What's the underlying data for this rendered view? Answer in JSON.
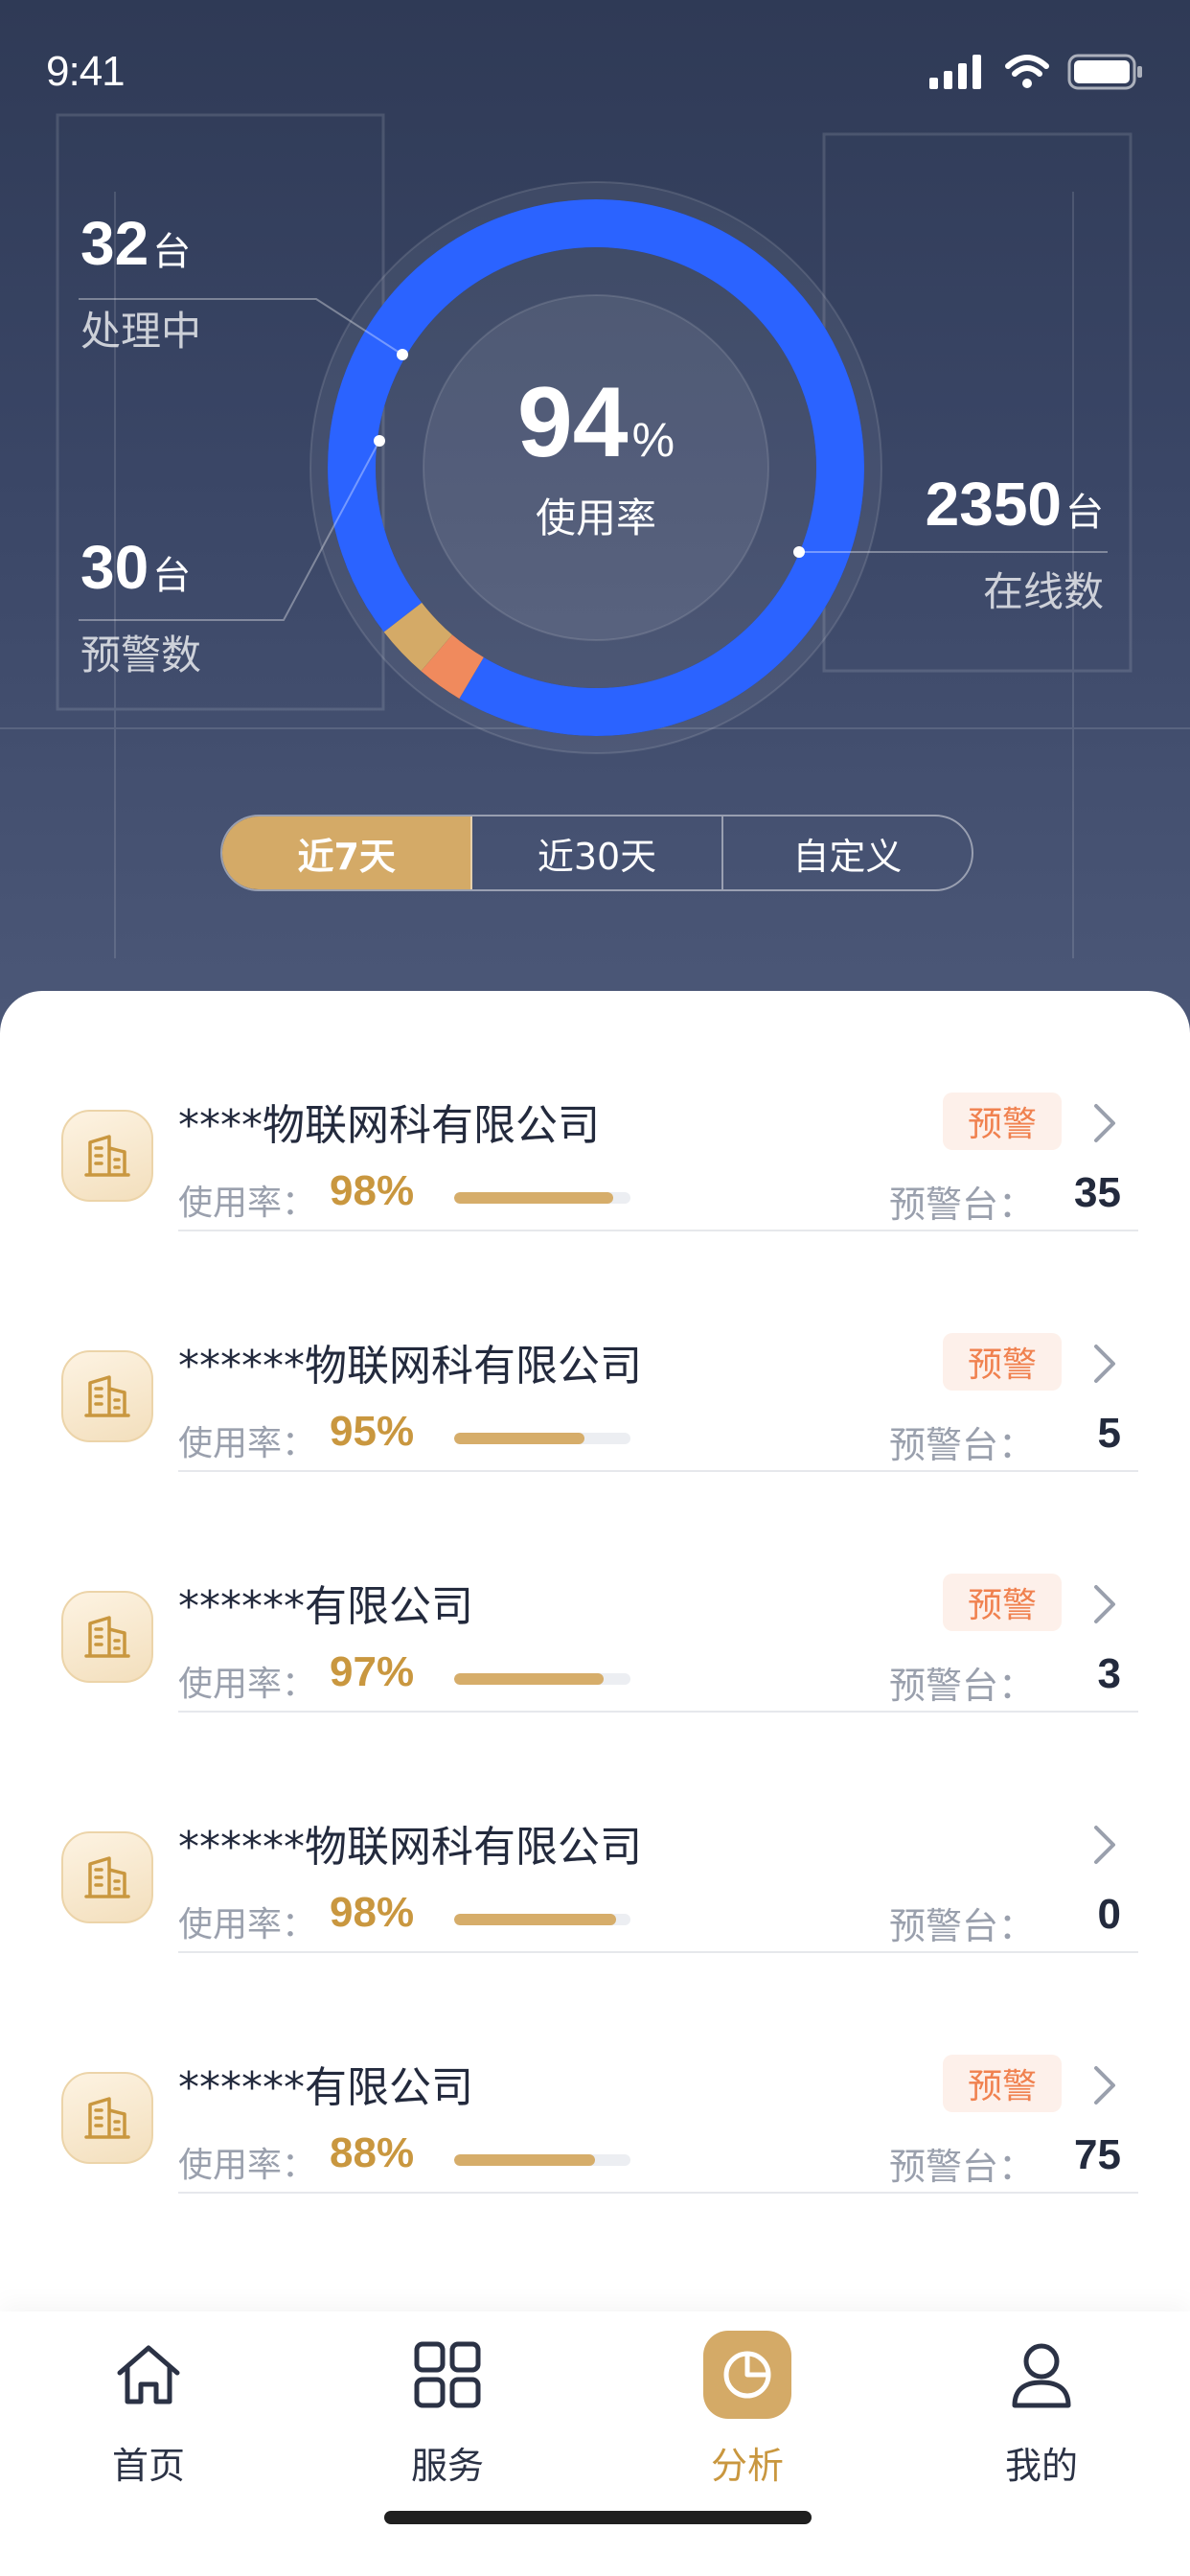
{
  "status_bar": {
    "time": "9:41"
  },
  "summary": {
    "usage_rate_value": "94",
    "usage_rate_unit": "%",
    "usage_rate_label": "使用率",
    "ring": {
      "online_fraction": 0.94,
      "warning_fraction": 0.028,
      "processing_fraction": 0.032
    },
    "processing": {
      "count": "32",
      "unit": "台",
      "label": "处理中"
    },
    "warning": {
      "count": "30",
      "unit": "台",
      "label": "预警数"
    },
    "online": {
      "count": "2350",
      "unit": "台",
      "label": "在线数"
    },
    "colors": {
      "online": "#2b63ff",
      "warning": "#f08a5d",
      "processing": "#d4aa67"
    }
  },
  "range_tabs": [
    {
      "label": "近7天",
      "active": true
    },
    {
      "label": "近30天",
      "active": false
    },
    {
      "label": "自定义",
      "active": false
    }
  ],
  "companies": [
    {
      "name": "****物联网科有限公司",
      "rate_label": "使用率：",
      "rate": "98%",
      "rate_fraction": 0.9,
      "tag": "预警",
      "warn_label": "预警台：",
      "warn_count": "35"
    },
    {
      "name": "******物联网科有限公司",
      "rate_label": "使用率：",
      "rate": "95%",
      "rate_fraction": 0.74,
      "tag": "预警",
      "warn_label": "预警台：",
      "warn_count": "5"
    },
    {
      "name": "******有限公司",
      "rate_label": "使用率：",
      "rate": "97%",
      "rate_fraction": 0.85,
      "tag": "预警",
      "warn_label": "预警台：",
      "warn_count": "3"
    },
    {
      "name": "******物联网科有限公司",
      "rate_label": "使用率：",
      "rate": "98%",
      "rate_fraction": 0.92,
      "tag": "",
      "warn_label": "预警台：",
      "warn_count": "0"
    },
    {
      "name": "******有限公司",
      "rate_label": "使用率：",
      "rate": "88%",
      "rate_fraction": 0.8,
      "tag": "预警",
      "warn_label": "预警台：",
      "warn_count": "75"
    }
  ],
  "tabbar": [
    {
      "label": "首页",
      "icon": "home-icon",
      "active": false
    },
    {
      "label": "服务",
      "icon": "grid-icon",
      "active": false
    },
    {
      "label": "分析",
      "icon": "pie-chart-icon",
      "active": true
    },
    {
      "label": "我的",
      "icon": "user-icon",
      "active": false
    }
  ]
}
